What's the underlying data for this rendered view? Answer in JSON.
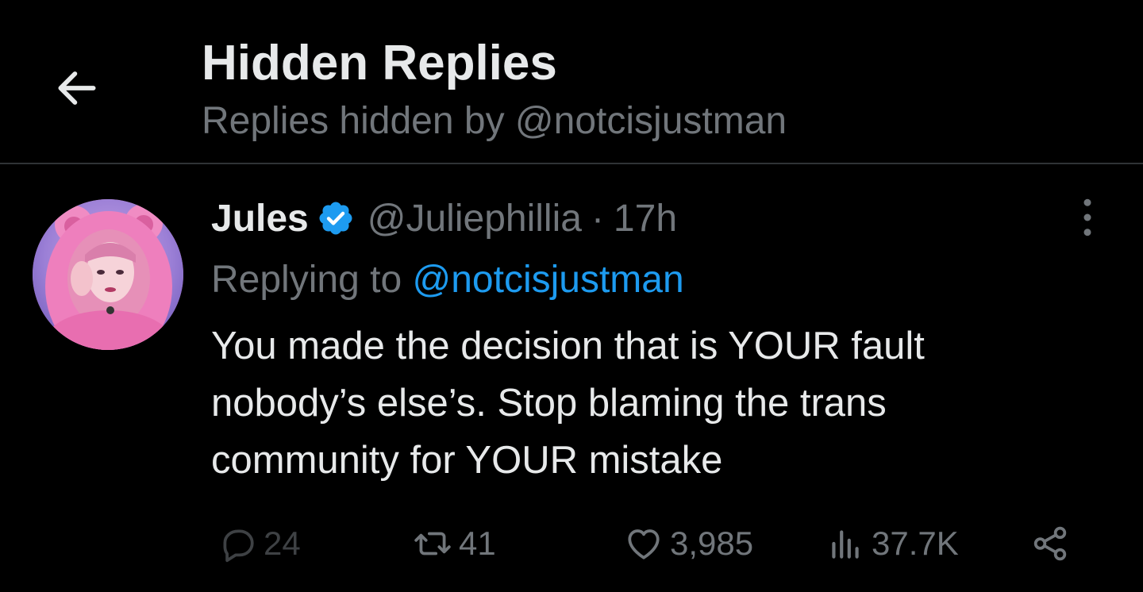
{
  "header": {
    "title": "Hidden Replies",
    "subtitle": "Replies hidden by @notcisjustman"
  },
  "tweet": {
    "display_name": "Jules",
    "verified": true,
    "handle": "@Juliephillia",
    "separator": "·",
    "time": "17h",
    "replying_prefix": "Replying to",
    "replying_to": "@notcisjustman",
    "text_lines": [
      "You made the decision that is YOUR fault",
      "nobody’s else’s. Stop blaming the trans",
      "community for YOUR mistake"
    ],
    "stats": {
      "replies": "24",
      "retweets": "41",
      "likes": "3,985",
      "views": "37.7K"
    }
  },
  "colors": {
    "background": "#000000",
    "text_primary": "#e7e9ea",
    "text_secondary": "#71767b",
    "accent": "#1d9bf0",
    "divider": "#2f3336"
  },
  "icons": {
    "back": "arrow-left-icon",
    "verified": "verified-badge-icon",
    "more": "more-vertical-icon",
    "reply": "reply-icon",
    "retweet": "retweet-icon",
    "like": "heart-icon",
    "views": "views-icon",
    "share": "share-icon"
  }
}
